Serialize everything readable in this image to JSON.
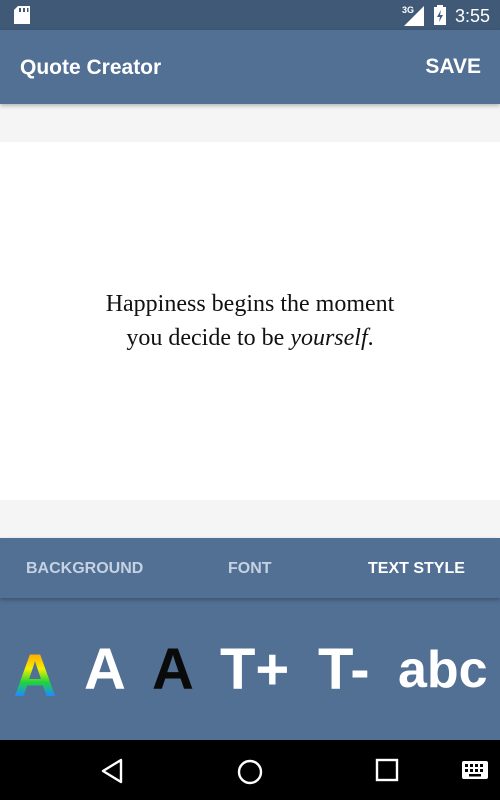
{
  "status_bar": {
    "network": "3G",
    "time": "3:55",
    "icons": [
      "sd-card-icon",
      "signal-icon",
      "battery-icon"
    ]
  },
  "app_bar": {
    "title": "Quote Creator",
    "save_label": "SAVE"
  },
  "quote": {
    "line1": "Happiness begins the moment",
    "line2_prefix": "you decide to be ",
    "line2_emphasis": "yourself",
    "line2_suffix": "."
  },
  "tabs": [
    {
      "label": "BACKGROUND",
      "active": false
    },
    {
      "label": "FONT",
      "active": false
    },
    {
      "label": "TEXT STYLE",
      "active": true
    }
  ],
  "tools": {
    "rainbow_color": "A",
    "white_color": "A",
    "black_color": "A",
    "increase_size": "T+",
    "decrease_size": "T-",
    "font_case": "abc"
  },
  "colors": {
    "status_bar": "#3f5976",
    "primary": "#526f94",
    "inactive_tab": "#c5d2e2",
    "nav_bar": "#000000"
  },
  "nav_bar": {
    "icons": [
      "back-icon",
      "home-icon",
      "recents-icon",
      "keyboard-icon"
    ]
  }
}
